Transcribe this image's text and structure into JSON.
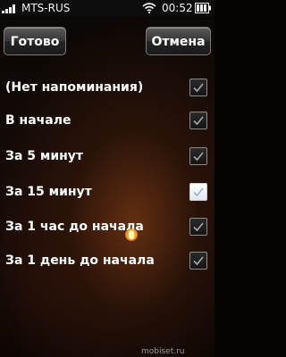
{
  "status_bar": {
    "carrier": "MTS-RUS",
    "time": "00:52",
    "icons": [
      "signal-icon",
      "wifi-icon",
      "battery-icon"
    ]
  },
  "toolbar": {
    "done_label": "Готово",
    "cancel_label": "Отмена"
  },
  "reminder_options": [
    {
      "label": "(Нет напоминания)",
      "selected": false
    },
    {
      "label": "В начале",
      "selected": false
    },
    {
      "label": "За 5 минут",
      "selected": false
    },
    {
      "label": "За 15 минут",
      "selected": true
    },
    {
      "label": "За 1 час до начала",
      "selected": false
    },
    {
      "label": "За 1 день до начала",
      "selected": false
    }
  ],
  "watermark": "mobiset.ru",
  "colors": {
    "text": "#ffffff",
    "background": "#0a0705",
    "accent_glow": "#803c16"
  }
}
